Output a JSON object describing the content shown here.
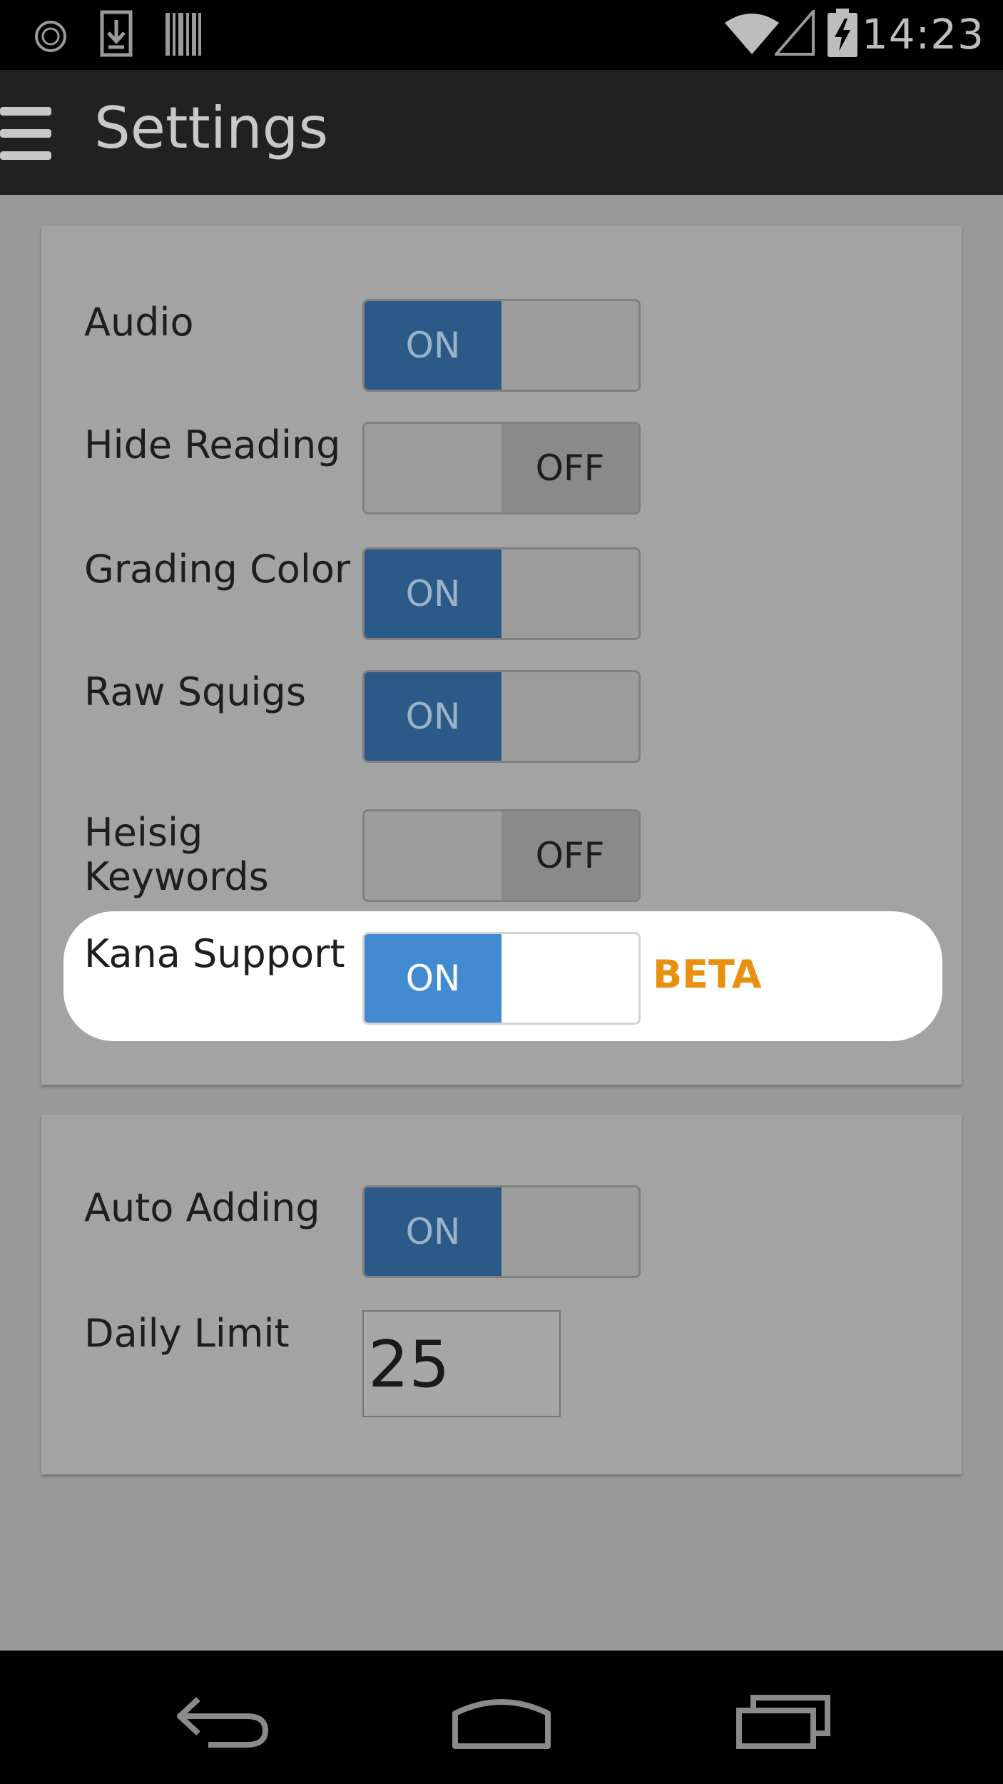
{
  "status_bar": {
    "time": "14:23"
  },
  "app_bar": {
    "title": "Settings"
  },
  "card_1": {
    "rows": [
      {
        "label": "Audio",
        "on_label": "ON",
        "state": "on"
      },
      {
        "label": "Hide Reading",
        "off_label": "OFF",
        "state": "off"
      },
      {
        "label": "Grading Color",
        "on_label": "ON",
        "state": "on"
      },
      {
        "label": "Raw Squigs",
        "on_label": "ON",
        "state": "on"
      },
      {
        "label": "Heisig Keywords",
        "label_line1": "Heisig",
        "label_line2": "Keywords",
        "off_label": "OFF",
        "state": "off"
      },
      {
        "label": "Kana Support",
        "on_label": "ON",
        "state": "on",
        "badge": "BETA"
      }
    ]
  },
  "card_2": {
    "auto_adding": {
      "label": "Auto Adding",
      "on_label": "ON",
      "state": "on"
    },
    "daily_limit": {
      "label": "Daily Limit",
      "value": "25"
    }
  },
  "icons": {
    "status": [
      "sync-icon",
      "download-icon",
      "barcode-icon",
      "wifi-icon",
      "signal-icon",
      "battery-charging-icon"
    ],
    "app_bar": [
      "menu-icon"
    ],
    "nav": [
      "back-icon",
      "home-icon",
      "recents-icon"
    ]
  },
  "colors": {
    "toggle_on": "#2c5a88",
    "toggle_on_highlight": "#428bd1",
    "beta": "#e8900f",
    "app_bar": "#212121"
  }
}
